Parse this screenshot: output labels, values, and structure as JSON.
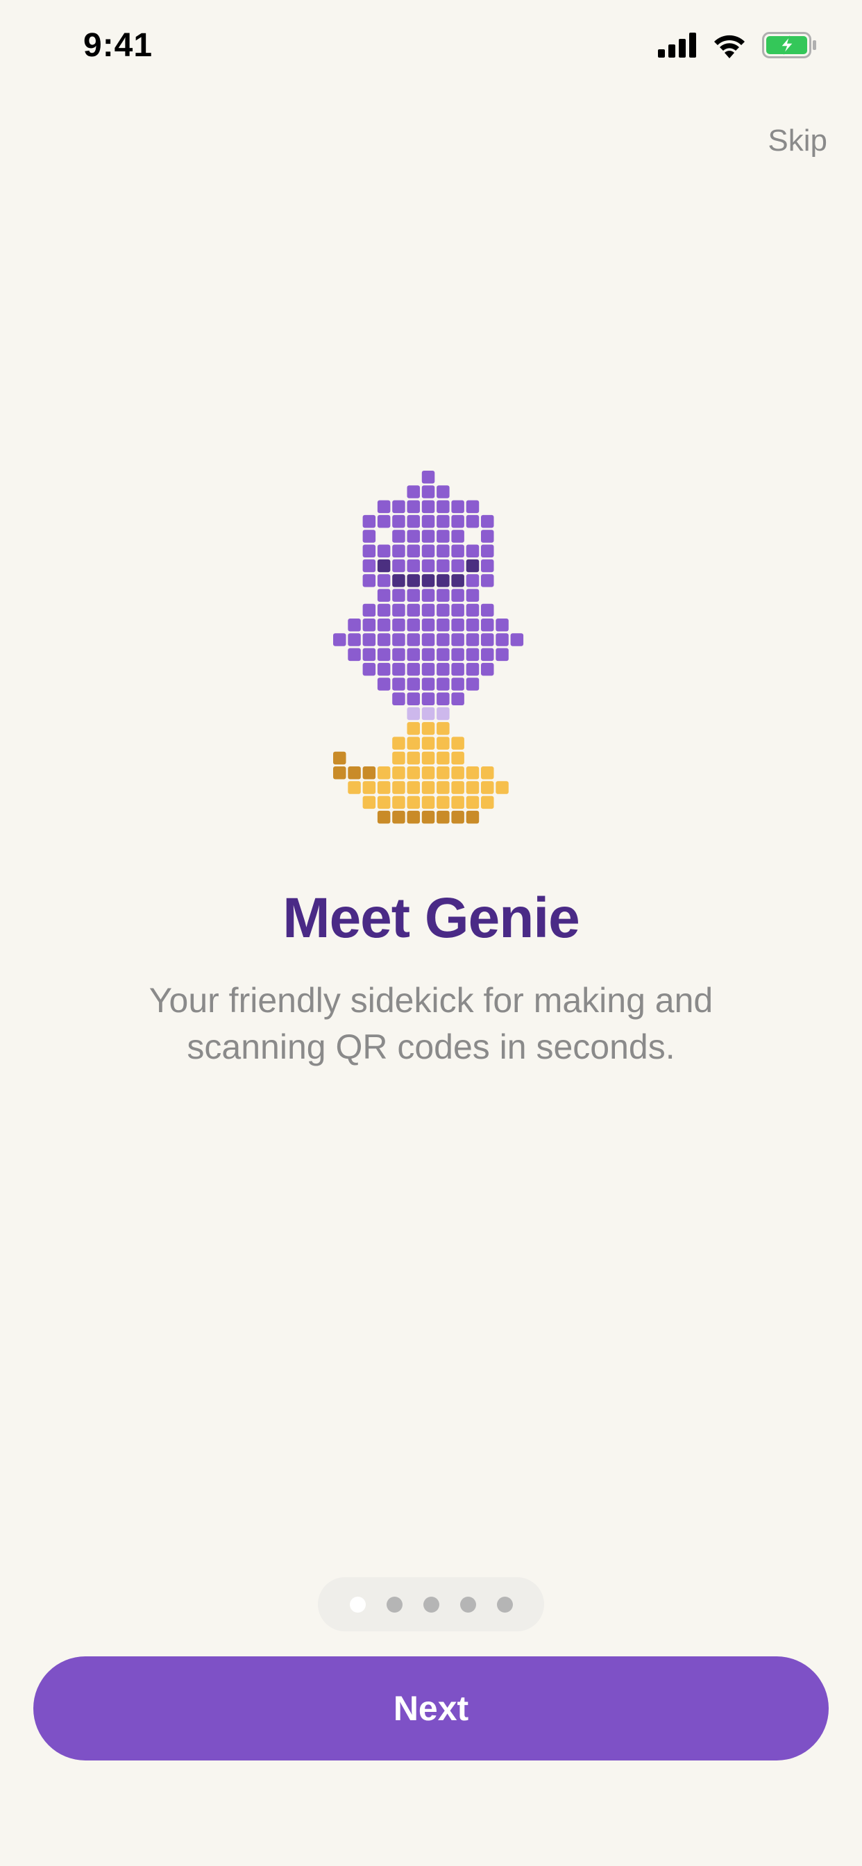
{
  "status_bar": {
    "time": "9:41",
    "icons": [
      "cellular-signal-icon",
      "wifi-icon",
      "battery-charging-icon"
    ],
    "battery_color": "#34C759"
  },
  "skip_label": "Skip",
  "mascot": {
    "icon": "pixel-genie-mascot",
    "colors": {
      "purple": "#8B5CCF",
      "dark_purple": "#4B2F80",
      "lavender": "#CDB8EC",
      "gold": "#F6BF4C",
      "dark_gold": "#C98B28"
    }
  },
  "title": "Meet Genie",
  "subtitle": "Your friendly sidekick for making and scanning QR codes in seconds.",
  "pager": {
    "count": 5,
    "active_index": 0
  },
  "next_label": "Next",
  "colors": {
    "accent": "#7E51C6",
    "title": "#4A2A86",
    "muted_text": "#8A8A8A",
    "background": "#F8F6F0"
  }
}
